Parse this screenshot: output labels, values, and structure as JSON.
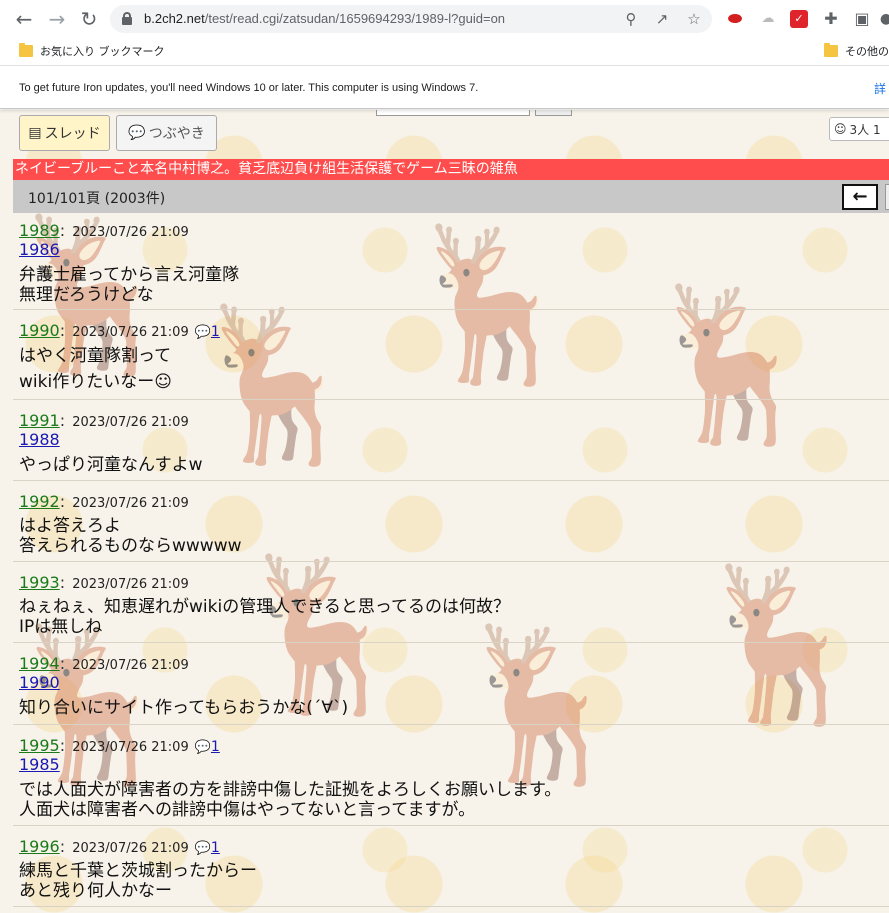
{
  "browser": {
    "url_host": "b.2ch2.net",
    "url_path": "/test/read.cgi/zatsudan/1659694293/1989-l?guid=on",
    "bookmarks": [
      {
        "label": "お気に入り ブックマーク"
      },
      {
        "label": "その他の"
      }
    ],
    "infobar": {
      "message": "To get future Iron updates, you'll need Windows 10 or later. This computer is using Windows 7.",
      "link": "詳"
    }
  },
  "page": {
    "tabs": {
      "thread": "スレッド",
      "tweet": "つぶやき"
    },
    "users_badge": "3人 1",
    "thread_title": "ネイビーブルーこと本名中村博之。貧乏底辺負け組生活保護でゲーム三昧の雑魚",
    "page_count": "101/101頁 (2003件)",
    "back_arrow": "←"
  },
  "posts": [
    {
      "num": "1989",
      "date": "2023/07/26 21:09",
      "reply": "",
      "anchor": "1986",
      "lines": [
        "弁護士雇ってから言え河童隊",
        "無理だろうけどな"
      ]
    },
    {
      "num": "1990",
      "date": "2023/07/26 21:09",
      "reply": "1",
      "anchor": "",
      "lines": [
        "はやく河童隊割って",
        "wiki作りたいなー☺"
      ]
    },
    {
      "num": "1991",
      "date": "2023/07/26 21:09",
      "reply": "",
      "anchor": "1988",
      "lines": [
        "やっぱり河童なんすよw"
      ]
    },
    {
      "num": "1992",
      "date": "2023/07/26 21:09",
      "reply": "",
      "anchor": "",
      "lines": [
        "はよ答えろよ",
        "答えられるものならwwwww"
      ]
    },
    {
      "num": "1993",
      "date": "2023/07/26 21:09",
      "reply": "",
      "anchor": "",
      "lines": [
        "ねぇねぇ、知恵遅れがwikiの管理人できると思ってるのは何故？",
        "IPは無しね"
      ]
    },
    {
      "num": "1994",
      "date": "2023/07/26 21:09",
      "reply": "",
      "anchor": "1990",
      "lines": [
        "知り合いにサイト作ってもらおうかな(´∀`)"
      ]
    },
    {
      "num": "1995",
      "date": "2023/07/26 21:09",
      "reply": "1",
      "anchor": "1985",
      "lines": [
        "では人面犬が障害者の方を誹謗中傷した証拠をよろしくお願いします。",
        "人面犬は障害者への誹謗中傷はやってないと言ってますが。"
      ]
    },
    {
      "num": "1996",
      "date": "2023/07/26 21:09",
      "reply": "1",
      "anchor": "",
      "lines": [
        "練馬と千葉と茨城割ったからー",
        "あと残り何人かなー"
      ]
    }
  ]
}
